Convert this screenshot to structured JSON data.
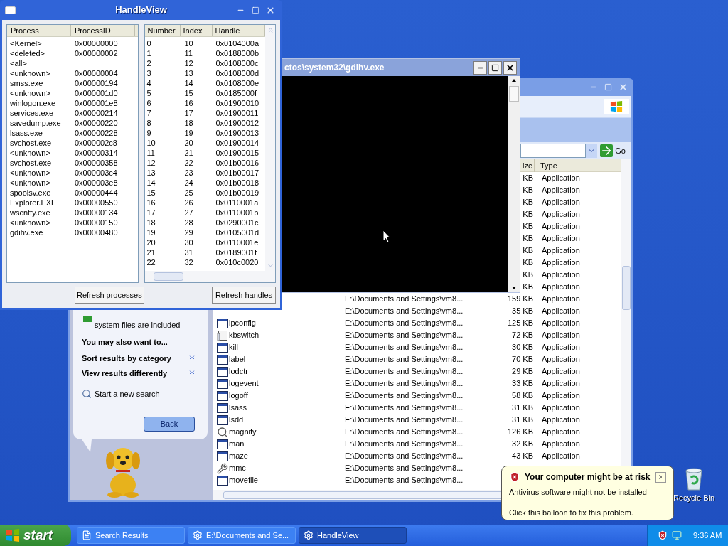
{
  "handleview": {
    "title": "HandleView",
    "process_columns": [
      "Process",
      "ProcessID"
    ],
    "processes": [
      {
        "name": "<Kernel>",
        "pid": "0x00000000"
      },
      {
        "name": "<deleted>",
        "pid": "0x00000002"
      },
      {
        "name": "<all>"
      },
      {
        "name": "<unknown>",
        "pid": "0x00000004"
      },
      {
        "name": "smss.exe",
        "pid": "0x00000194"
      },
      {
        "name": "<unknown>",
        "pid": "0x000001d0"
      },
      {
        "name": "winlogon.exe",
        "pid": "0x000001e8"
      },
      {
        "name": "services.exe",
        "pid": "0x00000214"
      },
      {
        "name": "savedump.exe",
        "pid": "0x00000220"
      },
      {
        "name": "lsass.exe",
        "pid": "0x00000228"
      },
      {
        "name": "svchost.exe",
        "pid": "0x000002c8"
      },
      {
        "name": "<unknown>",
        "pid": "0x00000314"
      },
      {
        "name": "svchost.exe",
        "pid": "0x00000358"
      },
      {
        "name": "<unknown>",
        "pid": "0x000003c4"
      },
      {
        "name": "<unknown>",
        "pid": "0x000003e8"
      },
      {
        "name": "spoolsv.exe",
        "pid": "0x00000444"
      },
      {
        "name": "Explorer.EXE",
        "pid": "0x00000550"
      },
      {
        "name": "wscntfy.exe",
        "pid": "0x00000134"
      },
      {
        "name": "<unknown>",
        "pid": "0x00000150"
      },
      {
        "name": "gdihv.exe",
        "pid": "0x00000480"
      }
    ],
    "handle_columns": [
      "Number",
      "Index",
      "Handle"
    ],
    "handles": [
      [
        "0",
        "10",
        "0x0104000a"
      ],
      [
        "1",
        "11",
        "0x0188000b"
      ],
      [
        "2",
        "12",
        "0x0108000c"
      ],
      [
        "3",
        "13",
        "0x0108000d"
      ],
      [
        "4",
        "14",
        "0x0108000e"
      ],
      [
        "5",
        "15",
        "0x0185000f"
      ],
      [
        "6",
        "16",
        "0x01900010"
      ],
      [
        "7",
        "17",
        "0x01900011"
      ],
      [
        "8",
        "18",
        "0x01900012"
      ],
      [
        "9",
        "19",
        "0x01900013"
      ],
      [
        "10",
        "20",
        "0x01900014"
      ],
      [
        "11",
        "21",
        "0x01900015"
      ],
      [
        "12",
        "22",
        "0x01b00016"
      ],
      [
        "13",
        "23",
        "0x01b00017"
      ],
      [
        "14",
        "24",
        "0x01b00018"
      ],
      [
        "15",
        "25",
        "0x01b00019"
      ],
      [
        "16",
        "26",
        "0x0110001a"
      ],
      [
        "17",
        "27",
        "0x0110001b"
      ],
      [
        "18",
        "28",
        "0x0290001c"
      ],
      [
        "19",
        "29",
        "0x0105001d"
      ],
      [
        "20",
        "30",
        "0x0110001e"
      ],
      [
        "21",
        "31",
        "0x0189001f"
      ],
      [
        "22",
        "32",
        "0x010c0020"
      ]
    ],
    "buttons": [
      "Refresh processes",
      "Refresh handles"
    ]
  },
  "console": {
    "title": "ctos\\system32\\gdihv.exe"
  },
  "explorer": {
    "go_label": "Go",
    "columns": [
      "ize",
      "Type"
    ],
    "rows": [
      {
        "size": "KB",
        "type": "Application"
      },
      {
        "size": "KB",
        "type": "Application"
      },
      {
        "size": "KB",
        "type": "Application"
      },
      {
        "size": "KB",
        "type": "Application"
      },
      {
        "size": "KB",
        "type": "Application"
      },
      {
        "size": "KB",
        "type": "Application"
      },
      {
        "size": "KB",
        "type": "Application"
      },
      {
        "size": "KB",
        "type": "Application"
      },
      {
        "size": "KB",
        "type": "Application"
      },
      {
        "size": "KB",
        "type": "Application"
      },
      {
        "path": "E:\\Documents and Settings\\vm8...",
        "size": "159 KB",
        "type": "Application"
      },
      {
        "path": "E:\\Documents and Settings\\vm8...",
        "size": "35 KB",
        "type": "Application"
      },
      {
        "kind": "window",
        "name": "ipconfig",
        "path": "E:\\Documents and Settings\\vm8...",
        "size": "125 KB",
        "type": "Application"
      },
      {
        "kind": "document",
        "name": "kbswitch",
        "path": "E:\\Documents and Settings\\vm8...",
        "size": "72 KB",
        "type": "Application"
      },
      {
        "kind": "window",
        "name": "kill",
        "path": "E:\\Documents and Settings\\vm8...",
        "size": "30 KB",
        "type": "Application"
      },
      {
        "kind": "window",
        "name": "label",
        "path": "E:\\Documents and Settings\\vm8...",
        "size": "70 KB",
        "type": "Application"
      },
      {
        "kind": "window",
        "name": "lodctr",
        "path": "E:\\Documents and Settings\\vm8...",
        "size": "29 KB",
        "type": "Application"
      },
      {
        "kind": "window",
        "name": "logevent",
        "path": "E:\\Documents and Settings\\vm8...",
        "size": "33 KB",
        "type": "Application"
      },
      {
        "kind": "window",
        "name": "logoff",
        "path": "E:\\Documents and Settings\\vm8...",
        "size": "58 KB",
        "type": "Application"
      },
      {
        "kind": "window",
        "name": "lsass",
        "path": "E:\\Documents and Settings\\vm8...",
        "size": "31 KB",
        "type": "Application"
      },
      {
        "kind": "window",
        "name": "lsdd",
        "path": "E:\\Documents and Settings\\vm8...",
        "size": "31 KB",
        "type": "Application"
      },
      {
        "kind": "magnifier",
        "name": "magnify",
        "path": "E:\\Documents and Settings\\vm8...",
        "size": "126 KB",
        "type": "Application"
      },
      {
        "kind": "window",
        "name": "man",
        "path": "E:\\Documents and Settings\\vm8...",
        "size": "32 KB",
        "type": "Application"
      },
      {
        "kind": "window",
        "name": "maze",
        "path": "E:\\Documents and Settings\\vm8...",
        "size": "43 KB",
        "type": "Application"
      },
      {
        "kind": "tools",
        "name": "mmc",
        "path": "E:\\Documents and Settings\\vm8..."
      },
      {
        "kind": "window",
        "name": "movefile",
        "path": "E:\\Documents and Settings\\vm8..."
      }
    ],
    "sidebar": {
      "note": "system files are included",
      "heading": "You may also want to...",
      "options": [
        {
          "label": "Sort results by category",
          "expanded": false
        },
        {
          "label": "View results differently",
          "expanded": false
        }
      ],
      "search_link": "Start a new search",
      "back": "Back"
    }
  },
  "balloon": {
    "title": "Your computer might be at risk",
    "lines": [
      "Antivirus software might not be installed",
      "Click this balloon to fix this problem."
    ]
  },
  "desktop_icons": [
    {
      "label": "Recycle Bin"
    }
  ],
  "taskbar": {
    "start": "start",
    "tasks": [
      {
        "kind": "document",
        "label": "Search Results",
        "selected": false
      },
      {
        "kind": "gear",
        "label": "E:\\Documents and Se...",
        "selected": false
      },
      {
        "kind": "gear",
        "label": "HandleView",
        "selected": true
      }
    ],
    "clock": "9:36 AM"
  }
}
